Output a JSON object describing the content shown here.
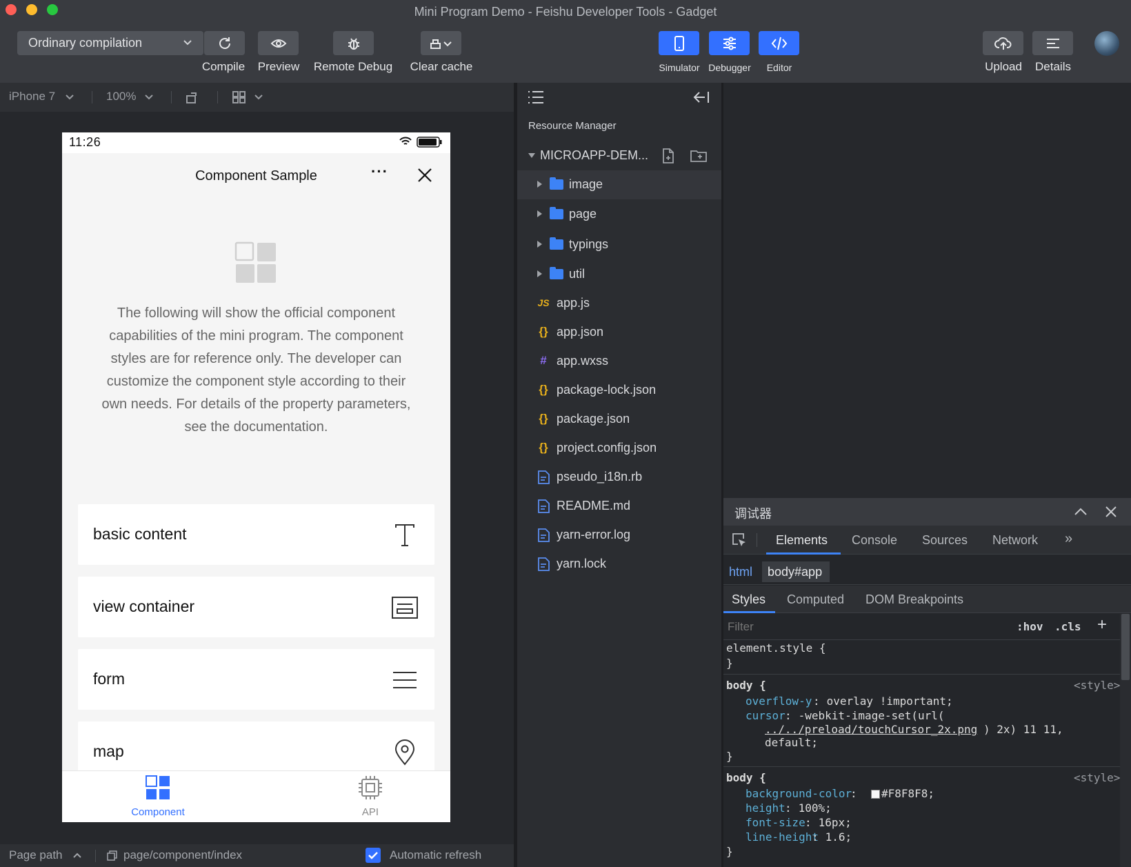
{
  "window": {
    "title": "Mini Program Demo - Feishu Developer Tools - Gadget"
  },
  "toolbar": {
    "compile_mode": "Ordinary compilation",
    "compile_label": "Compile",
    "preview_label": "Preview",
    "remote_debug_label": "Remote Debug",
    "clear_cache_label": "Clear cache",
    "simulator_label": "Simulator",
    "debugger_label": "Debugger",
    "editor_label": "Editor",
    "upload_label": "Upload",
    "details_label": "Details"
  },
  "simulator_bar": {
    "device": "iPhone 7",
    "zoom": "100%"
  },
  "phone": {
    "time": "11:26",
    "nav_title": "Component Sample",
    "more": "···",
    "description": "The following will show the official component capabilities of the mini program. The component styles are for reference only. The developer can customize the component style according to their own needs. For details of the property parameters, see the documentation.",
    "cards": [
      {
        "label": "basic content"
      },
      {
        "label": "view container"
      },
      {
        "label": "form"
      },
      {
        "label": "map"
      }
    ],
    "tabs": [
      {
        "label": "Component"
      },
      {
        "label": "API"
      }
    ]
  },
  "bottom_bar": {
    "page_path_label": "Page path",
    "page_path": "page/component/index",
    "auto_refresh_label": "Automatic refresh"
  },
  "explorer": {
    "title": "Resource Manager",
    "project": "MICROAPP-DEM...",
    "items": [
      {
        "name": "image",
        "type": "folder"
      },
      {
        "name": "page",
        "type": "folder"
      },
      {
        "name": "typings",
        "type": "folder"
      },
      {
        "name": "util",
        "type": "folder"
      },
      {
        "name": "app.js",
        "type": "js",
        "icon": "JS"
      },
      {
        "name": "app.json",
        "type": "json",
        "icon": "{}"
      },
      {
        "name": "app.wxss",
        "type": "css",
        "icon": "#"
      },
      {
        "name": "package-lock.json",
        "type": "json",
        "icon": "{}"
      },
      {
        "name": "package.json",
        "type": "json",
        "icon": "{}"
      },
      {
        "name": "project.config.json",
        "type": "json",
        "icon": "{}"
      },
      {
        "name": "pseudo_i18n.rb",
        "type": "file"
      },
      {
        "name": "README.md",
        "type": "file"
      },
      {
        "name": "yarn-error.log",
        "type": "file"
      },
      {
        "name": "yarn.lock",
        "type": "file"
      }
    ]
  },
  "debugger": {
    "title": "调试器",
    "tabs": [
      "Elements",
      "Console",
      "Sources",
      "Network"
    ],
    "more": "»",
    "breadcrumbs": [
      "html",
      "body#app"
    ],
    "style_tabs": [
      "Styles",
      "Computed",
      "DOM Breakpoints"
    ],
    "filter_placeholder": "Filter",
    "hov": ":hov",
    "cls": ".cls",
    "plus": "+",
    "rules": {
      "element_style_open": "element.style {",
      "close": "}",
      "body_open": "body {",
      "source": "<style>",
      "r1_p1_name": "overflow-y",
      "r1_p1_val": " overlay !important;",
      "r1_p2_name": "cursor",
      "r1_p2_val": " -webkit-image-set(url(",
      "r1_p2_url": "../../preload/touchCursor_2x.png",
      "r1_p2_tail": ") 2x) 11 11,",
      "r1_p2_tail2": "default;",
      "r2_p1_name": "background-color",
      "r2_p1_val": "#F8F8F8;",
      "r2_p2_name": "height",
      "r2_p2_val": " 100%;",
      "r2_p3_name": "font-size",
      "r2_p3_val": " 16px;",
      "r2_p4_name": "line-height",
      "r2_p4_val": " 1.6;"
    }
  },
  "colors": {
    "accent": "#3370ff",
    "folder": "#3d83f6",
    "json_icon": "#e8b01c",
    "css_icon": "#8b6cf0"
  }
}
